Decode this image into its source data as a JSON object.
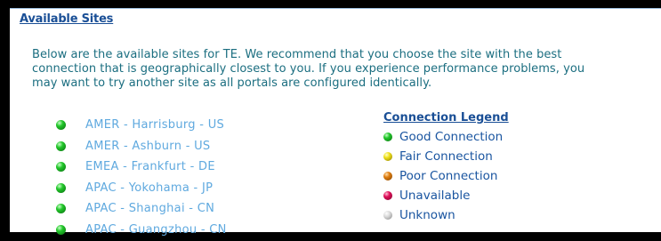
{
  "header": {
    "title": "Available Sites"
  },
  "intro": {
    "line1": "Below are the available sites for TE.  We recommend that you choose the site with the best",
    "line2": "connection that is geographically closest to you.  If you experience performance problems, you",
    "line3": "may want to try another site as all portals are configured identically."
  },
  "sites": [
    {
      "label": "AMER - Harrisburg - US",
      "status": "green"
    },
    {
      "label": "AMER - Ashburn - US",
      "status": "green"
    },
    {
      "label": "EMEA - Frankfurt - DE",
      "status": "green"
    },
    {
      "label": "APAC - Yokohama - JP",
      "status": "green"
    },
    {
      "label": "APAC - Shanghai - CN",
      "status": "green"
    },
    {
      "label": "APAC - Guangzhou - CN",
      "status": "green"
    }
  ],
  "legend": {
    "title": "Connection Legend",
    "items": [
      {
        "label": "Good Connection",
        "color": "green"
      },
      {
        "label": "Fair Connection",
        "color": "yellow"
      },
      {
        "label": "Poor Connection",
        "color": "orange"
      },
      {
        "label": "Unavailable",
        "color": "red"
      },
      {
        "label": "Unknown",
        "color": "gray"
      }
    ]
  },
  "colors": {
    "background": "#000000",
    "panel": "#ffffff",
    "header": "#1a4f96",
    "intro_text": "#1b6e80",
    "site_link": "#5fa9df",
    "legend_text": "#1a55a0"
  }
}
